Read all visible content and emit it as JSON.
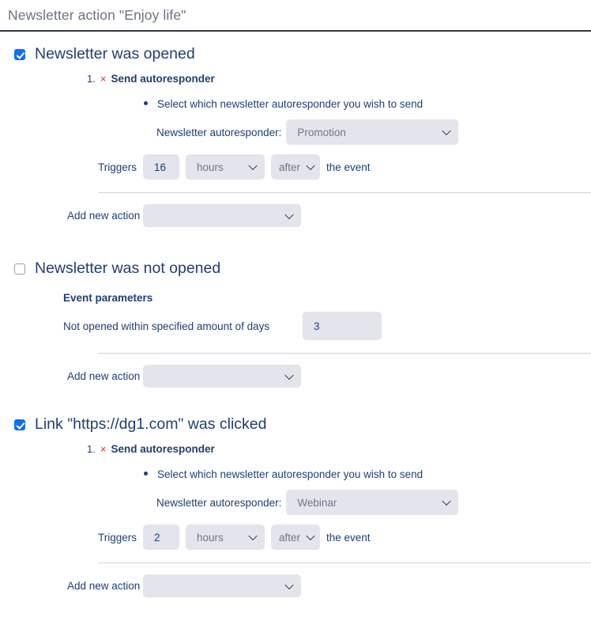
{
  "page": {
    "title": "Newsletter action \"Enjoy life\""
  },
  "labels": {
    "action_index": "1.",
    "remove_icon": "×",
    "send_autoresponder": "Send autoresponder",
    "bullet_hint": "Select which newsletter autoresponder you wish to send",
    "autoresponder_label": "Newsletter autoresponder:",
    "triggers_label": "Triggers",
    "the_event": "the event",
    "add_new_action": "Add new action",
    "event_parameters": "Event parameters",
    "not_opened_within": "Not opened within specified amount of days",
    "add_action_placeholder": ""
  },
  "colors": {
    "accent": "#0d6efd",
    "heading": "#1f3f73",
    "title": "#6b7280",
    "remove": "#e03131",
    "control_bg": "#e4e4ec",
    "rule": "#343a40",
    "divider": "#cfd4da"
  },
  "sections": [
    {
      "id": "newsletter-was-opened",
      "label": "Newsletter was opened",
      "checked": true,
      "action": {
        "index": "1.",
        "title": "Send autoresponder",
        "hint": "Select which newsletter autoresponder you wish to send",
        "autoresponder_label": "Newsletter autoresponder:",
        "autoresponder_value": "Promotion",
        "triggers_label": "Triggers",
        "triggers_amount": "16",
        "triggers_unit": "hours",
        "triggers_direction": "after",
        "triggers_trailing": "the event"
      },
      "add_action_label": "Add new action",
      "add_action_value": ""
    },
    {
      "id": "newsletter-was-not-opened",
      "label": "Newsletter was not opened",
      "checked": false,
      "params": {
        "title": "Event parameters",
        "label": "Not opened within specified amount of days",
        "value": "3"
      },
      "add_action_label": "Add new action",
      "add_action_value": ""
    },
    {
      "id": "link-was-clicked",
      "label": "Link \"https://dg1.com\" was clicked",
      "checked": true,
      "action": {
        "index": "1.",
        "title": "Send autoresponder",
        "hint": "Select which newsletter autoresponder you wish to send",
        "autoresponder_label": "Newsletter autoresponder:",
        "autoresponder_value": "Webinar",
        "triggers_label": "Triggers",
        "triggers_amount": "2",
        "triggers_unit": "hours",
        "triggers_direction": "after",
        "triggers_trailing": "the event"
      },
      "add_action_label": "Add new action",
      "add_action_value": ""
    }
  ]
}
